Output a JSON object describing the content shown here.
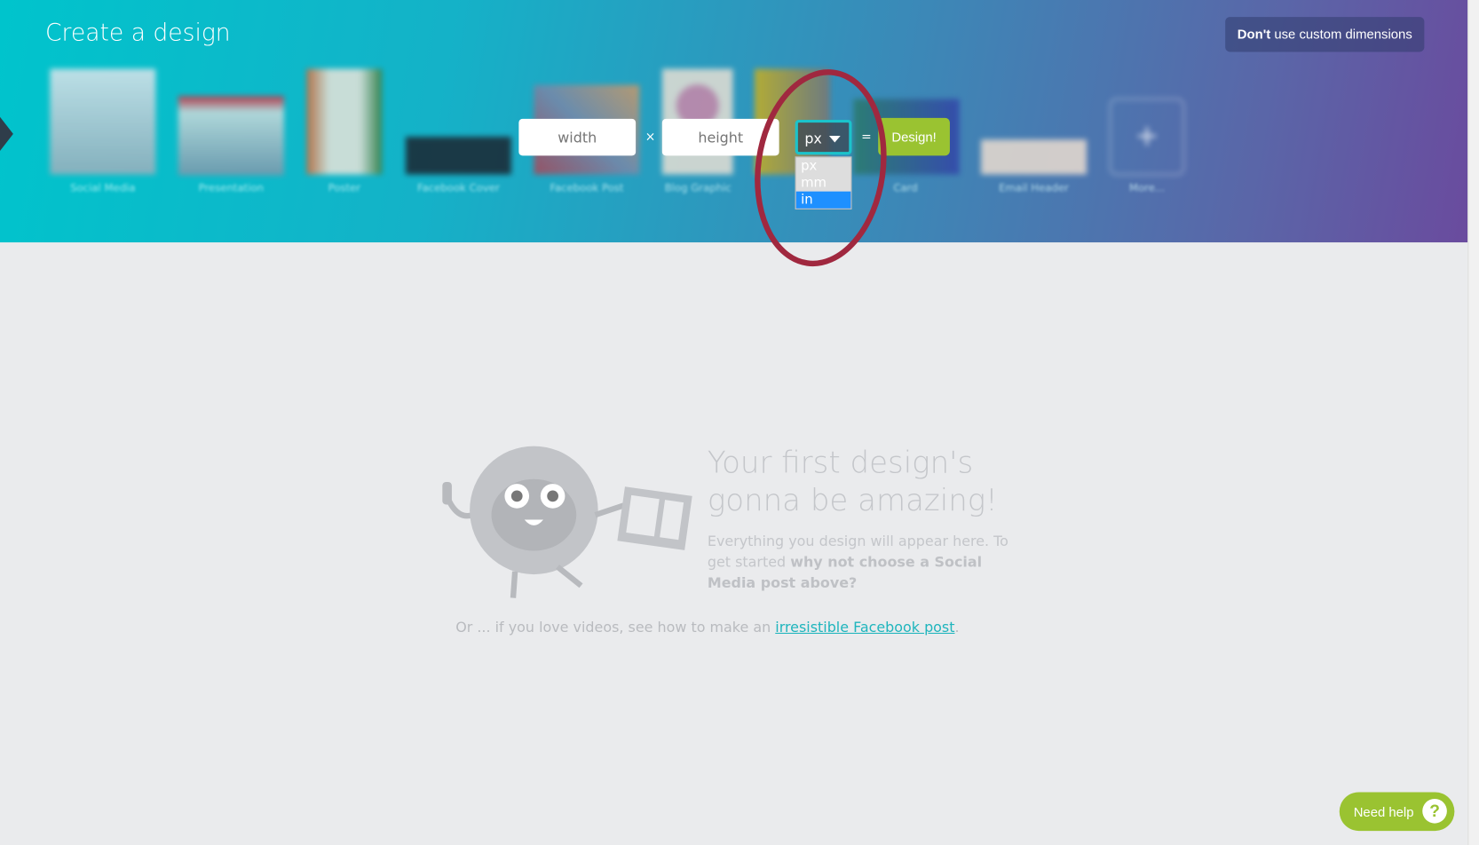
{
  "header": {
    "title": "Create a design",
    "no_custom_bold": "Don't",
    "no_custom_rest": " use custom dimensions"
  },
  "templates": [
    {
      "label": "Social Media",
      "color": "#c8d6de"
    },
    {
      "label": "Presentation",
      "color": "#b8cad6"
    },
    {
      "label": "Poster",
      "color": "#c46a3a"
    },
    {
      "label": "Facebook Cover",
      "color": "#1e2a34"
    },
    {
      "label": "Facebook Post",
      "color": "#8a6a8a"
    },
    {
      "label": "Blog Graphic",
      "color": "#d8c8c0"
    },
    {
      "label": "Card",
      "color": "#8a8a5a"
    },
    {
      "label": "Email Header",
      "color": "#e8d8c8"
    },
    {
      "label": "More...",
      "color": "transparent"
    }
  ],
  "custom": {
    "width_placeholder": "width",
    "height_placeholder": "height",
    "times": "×",
    "equals": "=",
    "unit_selected": "px",
    "unit_options": [
      "px",
      "mm",
      "in"
    ],
    "unit_highlighted": "in",
    "design_button": "Design!"
  },
  "empty": {
    "headline": "Your first design's gonna be amazing!",
    "desc_plain": "Everything you design will appear here. To get started ",
    "desc_bold": "why not choose a Social Media post above?",
    "or_prefix": "Or ... if you love videos, see how to make an ",
    "or_link": "irresistible Facebook post",
    "or_suffix": "."
  },
  "help": {
    "label": "Need help",
    "icon": "?"
  },
  "colors": {
    "accent": "#00c4cc",
    "green": "#9ac331",
    "annotation": "#a0283f",
    "highlight": "#1e90ff"
  }
}
